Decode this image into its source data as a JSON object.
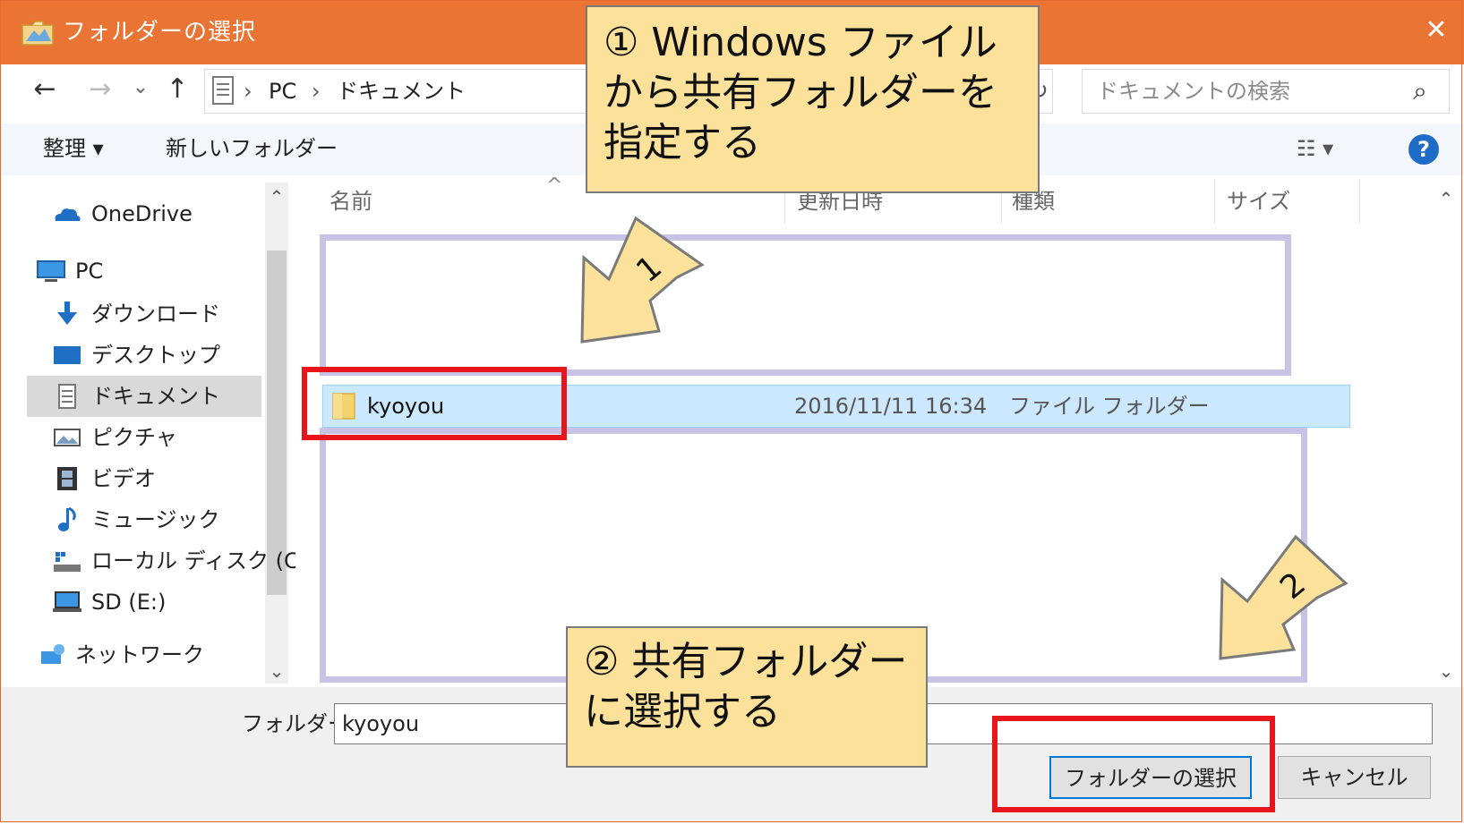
{
  "window": {
    "title": "フォルダーの選択",
    "close_glyph": "✕"
  },
  "address": {
    "back_glyph": "←",
    "forward_glyph": "→",
    "dropdown_glyph": "⌄",
    "up_glyph": "↑",
    "path": [
      "PC",
      "ドキュメント"
    ],
    "separator": "›",
    "refresh_glyph": "↻",
    "search_placeholder": "ドキュメントの検索",
    "search_glyph": "⌕"
  },
  "toolbar": {
    "organize": "整理 ▾",
    "new_folder": "新しいフォルダー",
    "view_glyph": "☷ ▾",
    "help_glyph": "?"
  },
  "nav": {
    "items": [
      {
        "label": "OneDrive",
        "icon": "onedrive-cloud-icon"
      },
      {
        "label": "PC",
        "icon": "pc-icon"
      },
      {
        "label": "ダウンロード",
        "icon": "download-arrow-icon"
      },
      {
        "label": "デスクトップ",
        "icon": "desktop-icon"
      },
      {
        "label": "ドキュメント",
        "icon": "document-icon",
        "selected": true
      },
      {
        "label": "ピクチャ",
        "icon": "pictures-icon"
      },
      {
        "label": "ビデオ",
        "icon": "video-icon"
      },
      {
        "label": "ミュージック",
        "icon": "music-note-icon"
      },
      {
        "label": "ローカル ディスク (C",
        "icon": "local-disk-icon"
      },
      {
        "label": "SD (E:)",
        "icon": "sd-drive-icon"
      },
      {
        "label": "ネットワーク",
        "icon": "network-icon"
      }
    ],
    "scroll_up": "⌃",
    "scroll_down": "⌄"
  },
  "list": {
    "columns": [
      "名前",
      "更新日時",
      "種類",
      "サイズ"
    ],
    "sort_glyph": "^",
    "rows": [
      {
        "name": "kyoyou",
        "modified": "2016/11/11 16:34",
        "type": "ファイル フォルダー",
        "size": ""
      }
    ],
    "scroll_up": "⌃",
    "scroll_down": "⌄"
  },
  "bottom": {
    "folder_label": "フォルダー:",
    "folder_value": "kyoyou",
    "select_button": "フォルダーの選択",
    "cancel_button": "キャンセル"
  },
  "annotations": {
    "callout1": "① Windows ファイルから共有フォルダーを指定する",
    "callout2": "② 共有フォルダーに選択する",
    "arrow1_label": "1",
    "arrow2_label": "2"
  },
  "colors": {
    "titlebar": "#ea7434",
    "callout": "#fbe19a",
    "highlight_red": "#e8151b",
    "highlight_purple": "#c8c3e6",
    "selection": "#cce8ff"
  }
}
